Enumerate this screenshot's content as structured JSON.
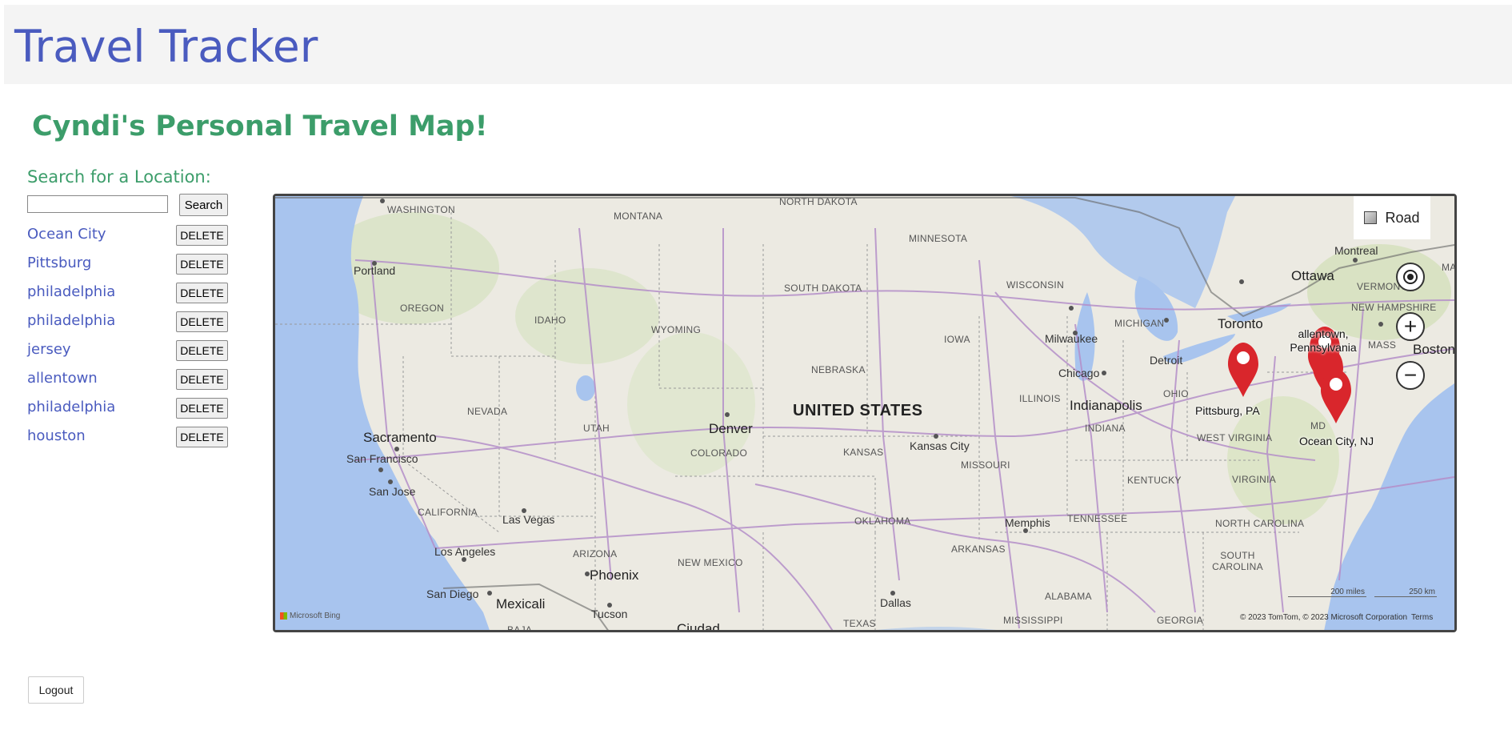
{
  "app_title": "Travel Tracker",
  "page_title": "Cyndi's Personal Travel Map!",
  "search": {
    "label": "Search for a Location:",
    "value": "",
    "placeholder": "",
    "button_label": "Search"
  },
  "locations": [
    {
      "name": "Ocean City",
      "delete_label": "DELETE"
    },
    {
      "name": "Pittsburg",
      "delete_label": "DELETE"
    },
    {
      "name": "philadelphia",
      "delete_label": "DELETE"
    },
    {
      "name": "philadelphia",
      "delete_label": "DELETE"
    },
    {
      "name": "jersey",
      "delete_label": "DELETE"
    },
    {
      "name": "allentown",
      "delete_label": "DELETE"
    },
    {
      "name": "philadelphia",
      "delete_label": "DELETE"
    },
    {
      "name": "houston",
      "delete_label": "DELETE"
    }
  ],
  "map": {
    "style_label": "Road",
    "country_label": "UNITED STATES",
    "pin_labels": {
      "pittsburgh": "Pittsburg, PA",
      "allentown": "allentown, Pennsylvania",
      "ocean_city": "Ocean City, NJ"
    },
    "states": [
      "WASHINGTON",
      "MONTANA",
      "NORTH DAKOTA",
      "MINNESOTA",
      "OREGON",
      "IDAHO",
      "WYOMING",
      "SOUTH DAKOTA",
      "WISCONSIN",
      "MICHIGAN",
      "IOWA",
      "NEBRASKA",
      "NEVADA",
      "UTAH",
      "COLORADO",
      "KANSAS",
      "MISSOURI",
      "ILLINOIS",
      "INDIANA",
      "OHIO",
      "WEST VIRGINIA",
      "KENTUCKY",
      "VIRGINIA",
      "CALIFORNIA",
      "ARIZONA",
      "NEW MEXICO",
      "OKLAHOMA",
      "ARKANSAS",
      "TENNESSEE",
      "NORTH CAROLINA",
      "SOUTH CAROLINA",
      "ALABAMA",
      "GEORGIA",
      "MISSISSIPPI",
      "TEXAS",
      "VERMONT",
      "NEW HAMPSHIRE",
      "MASS",
      "MD",
      "MAIN",
      "BAJA"
    ],
    "cities": [
      "Portland",
      "Sacramento",
      "San Francisco",
      "San Jose",
      "Las Vegas",
      "Los Angeles",
      "San Diego",
      "Mexicali",
      "Tucson",
      "Phoenix",
      "Denver",
      "Kansas City",
      "Memphis",
      "Dallas",
      "Milwaukee",
      "Chicago",
      "Detroit",
      "Indianapolis",
      "Toronto",
      "Ottawa",
      "Montreal",
      "Boston",
      "Ciudad"
    ],
    "controls": {
      "locate": "locate-icon",
      "zoom_in": "+",
      "zoom_out": "−"
    },
    "scale": {
      "miles": "200 miles",
      "km": "250 km"
    },
    "attribution": "© 2023 TomTom, © 2023 Microsoft Corporation",
    "terms": "Terms",
    "logo": "Microsoft Bing"
  },
  "logout_label": "Logout",
  "colors": {
    "title_blue": "#4a5bbf",
    "heading_green": "#3c9d6a",
    "pin_red": "#d9262c",
    "water": "#a8c4ee",
    "road": "#b48fc9"
  }
}
